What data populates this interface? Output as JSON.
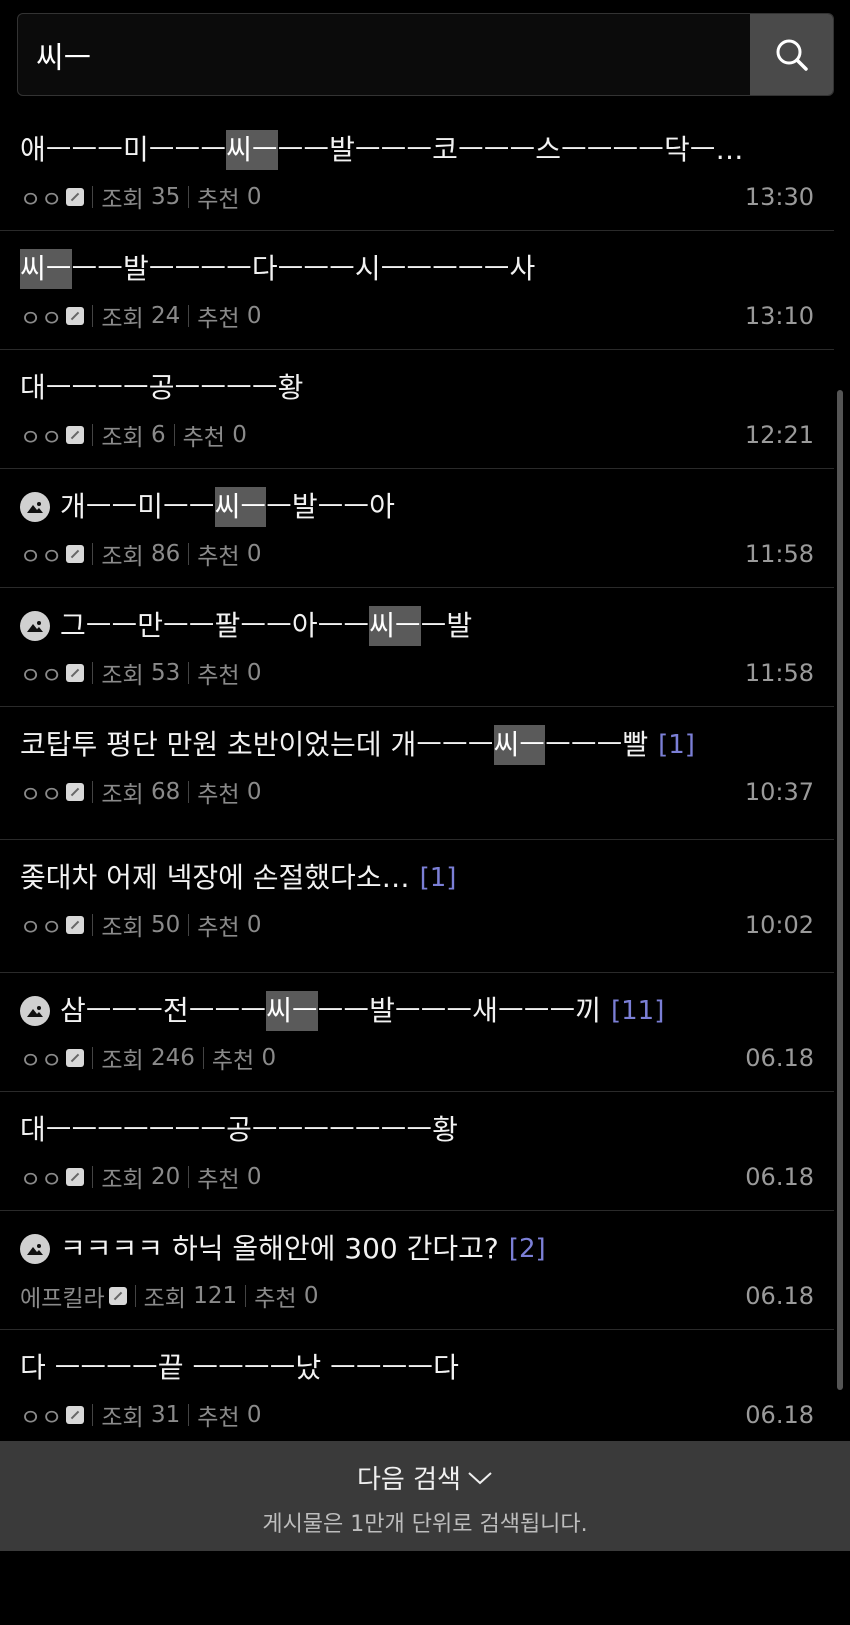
{
  "search": {
    "value": "씨ㅡ",
    "icon": "search-icon"
  },
  "posts": [
    {
      "has_image": false,
      "parts": [
        {
          "t": "애ㅡㅡㅡ미ㅡㅡㅡ",
          "h": false
        },
        {
          "t": "씨ㅡ",
          "h": true
        },
        {
          "t": "ㅡㅡ발ㅡㅡㅡ코ㅡㅡㅡ스ㅡㅡㅡㅡ닥ㅡ…",
          "h": false
        }
      ],
      "comments": "",
      "author": "ㅇㅇ",
      "views_label": "조회",
      "views": "35",
      "rec_label": "추천",
      "rec": "0",
      "time": "13:30"
    },
    {
      "has_image": false,
      "parts": [
        {
          "t": "씨ㅡ",
          "h": true
        },
        {
          "t": "ㅡㅡ발ㅡㅡㅡㅡ다ㅡㅡㅡ시ㅡㅡㅡㅡㅡ사",
          "h": false
        }
      ],
      "comments": "",
      "author": "ㅇㅇ",
      "views_label": "조회",
      "views": "24",
      "rec_label": "추천",
      "rec": "0",
      "time": "13:10"
    },
    {
      "has_image": false,
      "parts": [
        {
          "t": "대ㅡㅡㅡㅡ공ㅡㅡㅡㅡ황",
          "h": false
        }
      ],
      "comments": "",
      "author": "ㅇㅇ",
      "views_label": "조회",
      "views": "6",
      "rec_label": "추천",
      "rec": "0",
      "time": "12:21"
    },
    {
      "has_image": true,
      "parts": [
        {
          "t": "개ㅡㅡ미ㅡㅡ",
          "h": false
        },
        {
          "t": "씨ㅡ",
          "h": true
        },
        {
          "t": "ㅡ발ㅡㅡ아",
          "h": false
        }
      ],
      "comments": "",
      "author": "ㅇㅇ",
      "views_label": "조회",
      "views": "86",
      "rec_label": "추천",
      "rec": "0",
      "time": "11:58"
    },
    {
      "has_image": true,
      "parts": [
        {
          "t": "그ㅡㅡ만ㅡㅡ팔ㅡㅡ아ㅡㅡ",
          "h": false
        },
        {
          "t": "씨ㅡ",
          "h": true
        },
        {
          "t": "ㅡ발",
          "h": false
        }
      ],
      "comments": "",
      "author": "ㅇㅇ",
      "views_label": "조회",
      "views": "53",
      "rec_label": "추천",
      "rec": "0",
      "time": "11:58"
    },
    {
      "has_image": false,
      "tall": true,
      "parts": [
        {
          "t": "코탑투 평단 만원 초반이었는데 개ㅡㅡㅡ",
          "h": false
        },
        {
          "t": "씨ㅡ",
          "h": true
        },
        {
          "t": "ㅡㅡㅡ빨",
          "h": false
        }
      ],
      "comments": "[1]",
      "author": "ㅇㅇ",
      "views_label": "조회",
      "views": "68",
      "rec_label": "추천",
      "rec": "0",
      "time": "10:37"
    },
    {
      "has_image": false,
      "tall": true,
      "parts": [
        {
          "t": "좆대차 어제 넥장에 손절했다소…",
          "h": false
        }
      ],
      "comments": "[1]",
      "author": "ㅇㅇ",
      "views_label": "조회",
      "views": "50",
      "rec_label": "추천",
      "rec": "0",
      "time": "10:02"
    },
    {
      "has_image": true,
      "parts": [
        {
          "t": "삼ㅡㅡㅡ전ㅡㅡㅡ",
          "h": false
        },
        {
          "t": "씨ㅡ",
          "h": true
        },
        {
          "t": "ㅡㅡ발ㅡㅡㅡ새ㅡㅡㅡ끼",
          "h": false
        }
      ],
      "comments": "[11]",
      "author": "ㅇㅇ",
      "views_label": "조회",
      "views": "246",
      "rec_label": "추천",
      "rec": "0",
      "time": "06.18"
    },
    {
      "has_image": false,
      "parts": [
        {
          "t": "대ㅡㅡㅡㅡㅡㅡㅡ공ㅡㅡㅡㅡㅡㅡㅡ황",
          "h": false
        }
      ],
      "comments": "",
      "author": "ㅇㅇ",
      "views_label": "조회",
      "views": "20",
      "rec_label": "추천",
      "rec": "0",
      "time": "06.18"
    },
    {
      "has_image": true,
      "parts": [
        {
          "t": "ㅋㅋㅋㅋ 하닉 올해안에 300 간다고?",
          "h": false
        }
      ],
      "comments": "[2]",
      "author": "에프킬라",
      "views_label": "조회",
      "views": "121",
      "rec_label": "추천",
      "rec": "0",
      "time": "06.18"
    },
    {
      "has_image": false,
      "parts": [
        {
          "t": "다 ㅡㅡㅡㅡ끝 ㅡㅡㅡㅡ났 ㅡㅡㅡㅡ다",
          "h": false
        }
      ],
      "comments": "",
      "author": "ㅇㅇ",
      "views_label": "조회",
      "views": "31",
      "rec_label": "추천",
      "rec": "0",
      "time": "06.18"
    }
  ],
  "footer": {
    "next_label": "다음 검색",
    "note": "게시물은 1만개 단위로 검색됩니다."
  },
  "colors": {
    "highlight": "#5a5a5a",
    "comment": "#7b7fd6",
    "footer_bg": "#3a3a3a"
  }
}
